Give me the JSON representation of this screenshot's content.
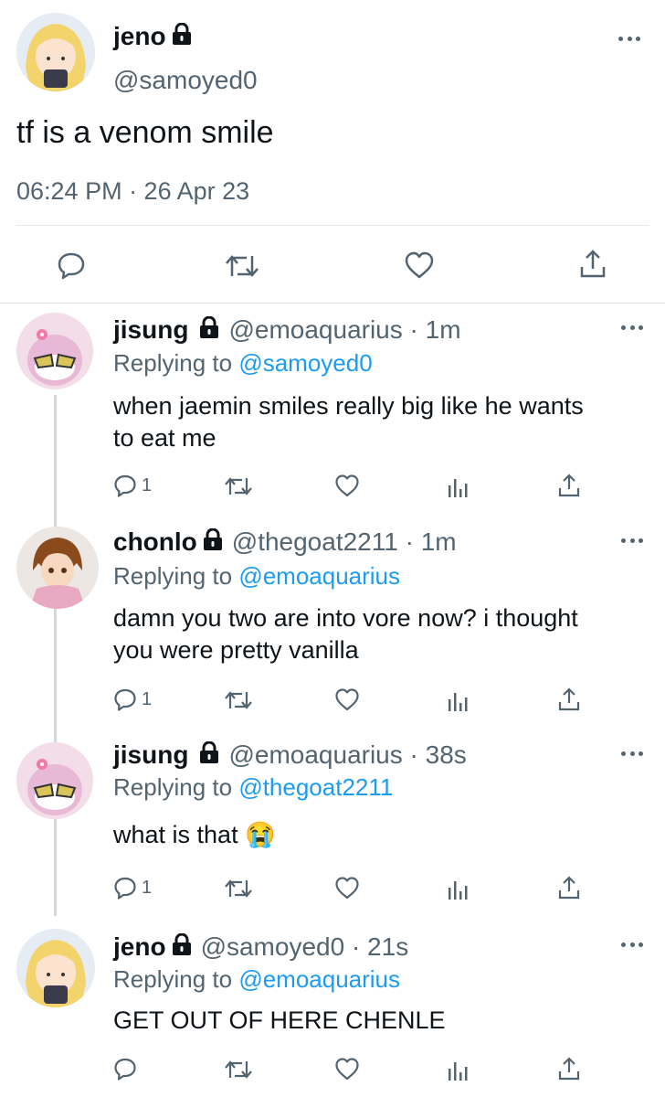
{
  "main_tweet": {
    "name": "jeno",
    "handle": "@samoyed0",
    "text": "tf is a venom smile",
    "timestamp": "06:24 PM · 26 Apr 23"
  },
  "replies": [
    {
      "name": "jisung",
      "handle": "@emoaquarius · 1m",
      "replying_prefix": "Replying to ",
      "replying_to": "@samoyed0",
      "text_lines": [
        "when jaemin smiles really big like he wants",
        "to eat me"
      ],
      "reply_count": "1"
    },
    {
      "name": "chonlo",
      "handle": "@thegoat2211 · 1m",
      "replying_prefix": "Replying to ",
      "replying_to": "@emoaquarius",
      "text_lines": [
        "damn you two are into vore now? i thought",
        "you were pretty vanilla"
      ],
      "reply_count": "1"
    },
    {
      "name": "jisung",
      "handle": "@emoaquarius · 38s",
      "replying_prefix": "Replying to ",
      "replying_to": "@thegoat2211",
      "text_lines": [
        "what is that 😭"
      ],
      "reply_count": "1"
    },
    {
      "name": "jeno",
      "handle": "@samoyed0 · 21s",
      "replying_prefix": "Replying to ",
      "replying_to": "@emoaquarius",
      "text_lines": [
        "GET OUT OF HERE CHENLE"
      ],
      "reply_count": ""
    }
  ],
  "colors": {
    "link": "#1d9bf0",
    "secondary": "#536471"
  },
  "icons": [
    "reply-icon",
    "retweet-icon",
    "like-icon",
    "analytics-icon",
    "share-icon",
    "lock-icon",
    "more-icon"
  ]
}
